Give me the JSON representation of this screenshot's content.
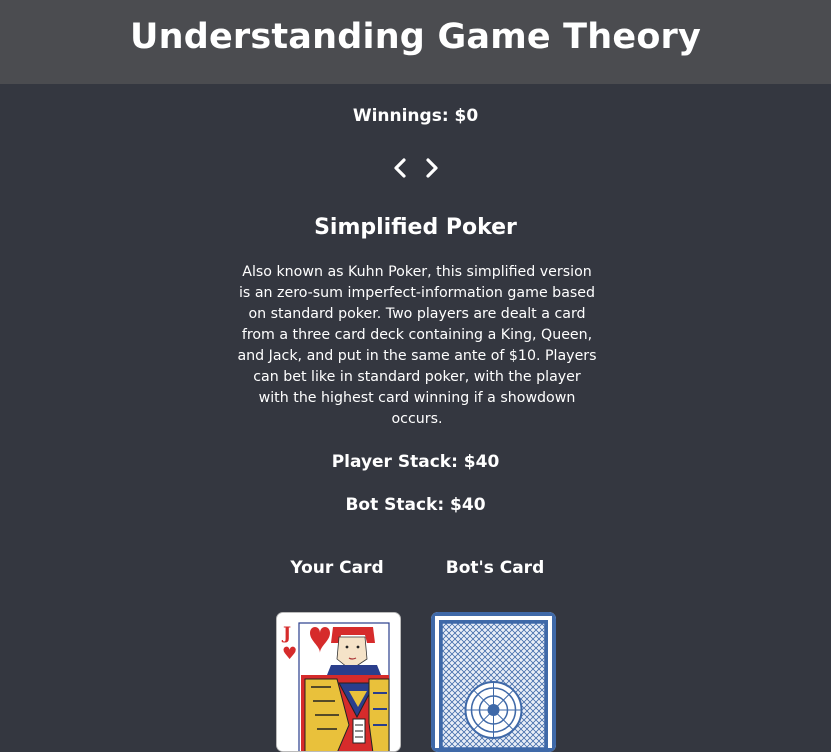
{
  "header": {
    "title": "Understanding Game Theory"
  },
  "winnings": {
    "text": "Winnings: $0"
  },
  "nav": {
    "prev_icon": "chevron-left-icon",
    "next_icon": "chevron-right-icon"
  },
  "game": {
    "title": "Simplified Poker",
    "description": "Also known as Kuhn Poker, this simplified version is an zero-sum imperfect-information game based on standard poker. Two players are dealt a card from a three card deck containing a King, Queen, and Jack, and put in the same ante of $10. Players can bet like in standard poker, with the player with the highest card winning if a showdown occurs."
  },
  "stacks": {
    "player": "Player Stack: $40",
    "bot": "Bot Stack: $40"
  },
  "cards": {
    "your_label": "Your Card",
    "bot_label": "Bot's Card",
    "your_rank": "J",
    "your_suit": "♥",
    "suit_color": "#d62b2b",
    "back_color": "#3f69a8"
  }
}
